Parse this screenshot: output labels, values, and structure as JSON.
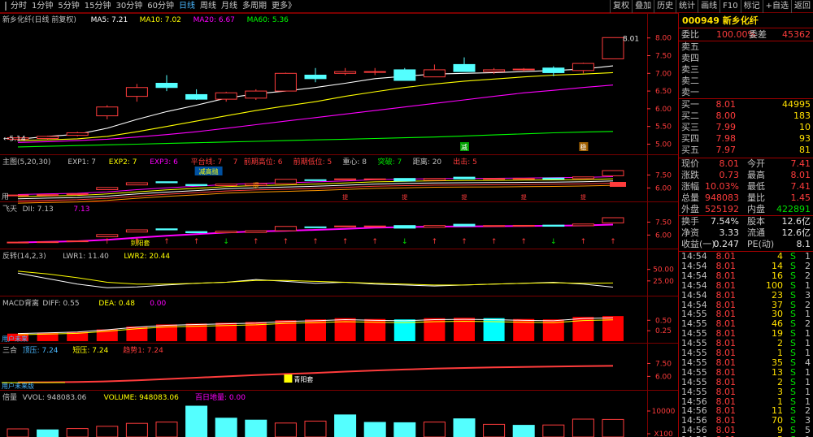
{
  "toolbar": {
    "periods": [
      "分时",
      "1分钟",
      "5分钟",
      "15分钟",
      "30分钟",
      "60分钟",
      "日线",
      "周线",
      "月线",
      "多周期",
      "更多》"
    ],
    "active_period": "日线",
    "tools": [
      "复权",
      "叠加",
      "历史",
      "统计",
      "画线",
      "F10",
      "标记",
      "+自选",
      "返回"
    ]
  },
  "colors": {
    "up": "#ff3c3c",
    "down": "#54ffff",
    "ma5": "#ffffff",
    "ma10": "#ffff00",
    "ma20": "#ff00ff",
    "ma60": "#00ff00",
    "grid": "#7a0000",
    "axis": "#ff3c3c"
  },
  "panes": {
    "main": {
      "title": "新乡化纤(日线 前复权)",
      "ma5": "MA5: 7.21",
      "ma10": "MA10: 7.02",
      "ma20": "MA20: 6.67",
      "ma60": "MA60: 5.36",
      "high_label": "8.01",
      "low_label": "5.14",
      "ticks": [
        "8.00",
        "7.50",
        "7.00",
        "6.50",
        "6.00",
        "5.50",
        "5.00"
      ],
      "marks": [
        "减",
        "稳"
      ]
    },
    "zhutu": {
      "items": [
        "主图(5,20,30)",
        "EXP1: 7",
        "EXP2: 7",
        "EXP3: 6",
        "平台线: 7",
        "7",
        "前期高位: 6",
        "前期低位: 5",
        "重心: 8",
        "突破: 7",
        "距离: 20",
        "出击: 5"
      ],
      "left_tag": "用",
      "mid_tag": "减高抛",
      "tag2": "提",
      "ticks": [
        "7.50",
        "6.00"
      ],
      "labels": [
        "提",
        "提",
        "提",
        "提",
        "提"
      ]
    },
    "feitian": {
      "items": [
        "飞天",
        "DII: 7.13",
        "7.13"
      ],
      "tag": "到阳套",
      "ticks": [
        "7.50",
        "6.00"
      ]
    },
    "fanzhong": {
      "items": [
        "反转(14,2,3)",
        "LWR1: 11.40",
        "LWR2: 20.44"
      ],
      "ticks": [
        "50.00",
        "25.00"
      ]
    },
    "macd": {
      "items": [
        "MACD背离",
        "DIFF: 0.55",
        "DEA: 0.48",
        "0.00"
      ],
      "left_tag": "用户未来",
      "ticks": [
        "0.50",
        "0.25"
      ]
    },
    "sanhe": {
      "items": [
        "三合",
        "顶压: 7.24",
        "短压: 7.24",
        "趋势1: 7.24"
      ],
      "left_tag": "用户未来版",
      "tag": "青阳套",
      "ticks": [
        "7.50",
        "6.00"
      ]
    },
    "volume": {
      "items": [
        "倍量",
        "VVOL: 948083.06",
        "VOLUME: 948083.06",
        "百日地量: 0.00"
      ],
      "ticks": [
        "10000",
        "X100"
      ]
    }
  },
  "chart_data": {
    "type": "candlestick",
    "x": [
      1,
      2,
      3,
      4,
      5,
      6,
      7,
      8,
      9,
      10,
      11,
      12,
      13,
      14,
      15,
      16,
      17,
      18,
      19,
      20
    ],
    "ohlc": [
      [
        5.14,
        5.2,
        5.1,
        5.18
      ],
      [
        5.16,
        5.24,
        5.12,
        5.22
      ],
      [
        5.25,
        5.35,
        5.22,
        5.32
      ],
      [
        5.8,
        6.1,
        5.7,
        6.05
      ],
      [
        6.35,
        6.7,
        6.2,
        6.6
      ],
      [
        6.72,
        6.95,
        6.5,
        6.6
      ],
      [
        6.4,
        6.55,
        6.25,
        6.27
      ],
      [
        6.27,
        6.48,
        6.2,
        6.45
      ],
      [
        6.3,
        6.55,
        6.25,
        6.5
      ],
      [
        6.5,
        7.02,
        6.5,
        7.0
      ],
      [
        6.95,
        7.15,
        6.75,
        6.85
      ],
      [
        7.0,
        7.15,
        6.95,
        7.05
      ],
      [
        7.05,
        7.15,
        6.95,
        7.05
      ],
      [
        7.1,
        7.15,
        6.8,
        6.8
      ],
      [
        6.9,
        7.25,
        6.9,
        7.1
      ],
      [
        7.25,
        7.45,
        7.05,
        7.05
      ],
      [
        7.05,
        7.15,
        6.98,
        7.1
      ],
      [
        7.1,
        7.15,
        7.05,
        7.12
      ],
      [
        7.15,
        7.2,
        6.92,
        7.02
      ],
      [
        7.08,
        7.3,
        7.0,
        7.28
      ],
      [
        7.41,
        8.01,
        7.41,
        8.01
      ]
    ],
    "ma5": [
      5.14,
      5.22,
      5.28,
      5.45,
      5.7,
      5.92,
      6.1,
      6.3,
      6.42,
      6.5,
      6.6,
      6.72,
      6.85,
      6.92,
      6.98,
      7.0,
      7.02,
      7.05,
      7.08,
      7.12,
      7.21
    ],
    "ma10": [
      5.1,
      5.12,
      5.15,
      5.22,
      5.35,
      5.5,
      5.65,
      5.8,
      5.95,
      6.08,
      6.2,
      6.35,
      6.48,
      6.6,
      6.7,
      6.78,
      6.84,
      6.9,
      6.95,
      6.98,
      7.02
    ],
    "ma20": [
      5.05,
      5.07,
      5.1,
      5.14,
      5.2,
      5.27,
      5.35,
      5.45,
      5.55,
      5.65,
      5.75,
      5.85,
      5.95,
      6.05,
      6.15,
      6.25,
      6.35,
      6.45,
      6.52,
      6.6,
      6.67
    ],
    "ma60": [
      4.92,
      4.94,
      4.96,
      4.98,
      5.0,
      5.02,
      5.04,
      5.06,
      5.08,
      5.1,
      5.12,
      5.14,
      5.16,
      5.18,
      5.2,
      5.23,
      5.26,
      5.29,
      5.32,
      5.34,
      5.36
    ],
    "ylim": [
      4.85,
      8.2
    ],
    "volume": [
      2500,
      2200,
      2600,
      3300,
      4200,
      4600,
      9500,
      5800,
      5200,
      4300,
      4900,
      6800,
      4500,
      4400,
      4600,
      5600,
      3900,
      3600,
      3700,
      5500,
      5400
    ],
    "vol_up": [
      true,
      false,
      true,
      true,
      true,
      true,
      false,
      false,
      false,
      true,
      true,
      false,
      false,
      false,
      true,
      false,
      true,
      false,
      true,
      true,
      true
    ],
    "macd": [
      0.18,
      0.2,
      0.22,
      0.28,
      0.35,
      0.4,
      0.42,
      0.44,
      0.46,
      0.5,
      0.52,
      0.55,
      0.53,
      0.52,
      0.55,
      0.56,
      0.55,
      0.53,
      0.52,
      0.58,
      0.6
    ],
    "macd_up": [
      true,
      true,
      true,
      true,
      true,
      true,
      true,
      true,
      true,
      true,
      true,
      true,
      true,
      false,
      true,
      true,
      false,
      true,
      true,
      true,
      true
    ],
    "lwr1": [
      42,
      30,
      18,
      10,
      12,
      16,
      20,
      22,
      28,
      24,
      20,
      22,
      18,
      16,
      14,
      16,
      18,
      20,
      22,
      18,
      11.4
    ],
    "lwr2": [
      46,
      40,
      32,
      22,
      18,
      18,
      20,
      22,
      26,
      26,
      24,
      22,
      20,
      18,
      16,
      16,
      18,
      20,
      21,
      20,
      20.44
    ]
  },
  "quote": {
    "code": "000949",
    "name": "新乡化纤",
    "wei_bi": "委比",
    "wei_bi_val": "100.00%",
    "wei_cha": "委差",
    "wei_cha_val": "45362",
    "sell": [
      "卖五",
      "卖四",
      "卖三",
      "卖二",
      "卖一"
    ],
    "buy": [
      {
        "label": "买一",
        "price": "8.01",
        "vol": "44995"
      },
      {
        "label": "买二",
        "price": "8.00",
        "vol": "183"
      },
      {
        "label": "买三",
        "price": "7.99",
        "vol": "10"
      },
      {
        "label": "买四",
        "price": "7.98",
        "vol": "93"
      },
      {
        "label": "买五",
        "price": "7.97",
        "vol": "81"
      }
    ],
    "stats": [
      {
        "l1": "现价",
        "v1": "8.01",
        "l2": "今开",
        "v2": "7.41"
      },
      {
        "l1": "涨跌",
        "v1": "0.73",
        "l2": "最高",
        "v2": "8.01"
      },
      {
        "l1": "涨幅",
        "v1": "10.03%",
        "l2": "最低",
        "v2": "7.41"
      },
      {
        "l1": "总量",
        "v1": "948083",
        "l2": "量比",
        "v2": "1.45"
      },
      {
        "l1": "外盘",
        "v1": "525192",
        "l2": "内盘",
        "v2": "422891"
      }
    ],
    "stats2": [
      {
        "l1": "换手",
        "v1": "7.54%",
        "l2": "股本",
        "v2": "12.6亿"
      },
      {
        "l1": "净资",
        "v1": "3.33",
        "l2": "流通",
        "v2": "12.6亿"
      },
      {
        "l1": "收益(一)",
        "v1": "0.247",
        "l2": "PE(动)",
        "v2": "8.1"
      }
    ],
    "ticks": [
      {
        "t": "14:54",
        "p": "8.01",
        "v": "4",
        "bs": "S",
        "n": "1"
      },
      {
        "t": "14:54",
        "p": "8.01",
        "v": "14",
        "bs": "S",
        "n": "2"
      },
      {
        "t": "14:54",
        "p": "8.01",
        "v": "16",
        "bs": "S",
        "n": "2"
      },
      {
        "t": "14:54",
        "p": "8.01",
        "v": "100",
        "bs": "S",
        "n": "1"
      },
      {
        "t": "14:54",
        "p": "8.01",
        "v": "23",
        "bs": "S",
        "n": "3"
      },
      {
        "t": "14:54",
        "p": "8.01",
        "v": "37",
        "bs": "S",
        "n": "2"
      },
      {
        "t": "14:55",
        "p": "8.01",
        "v": "30",
        "bs": "S",
        "n": "1"
      },
      {
        "t": "14:55",
        "p": "8.01",
        "v": "46",
        "bs": "S",
        "n": "2"
      },
      {
        "t": "14:55",
        "p": "8.01",
        "v": "19",
        "bs": "S",
        "n": "1"
      },
      {
        "t": "14:55",
        "p": "8.01",
        "v": "2",
        "bs": "S",
        "n": "1"
      },
      {
        "t": "14:55",
        "p": "8.01",
        "v": "1",
        "bs": "S",
        "n": "1"
      },
      {
        "t": "14:55",
        "p": "8.01",
        "v": "35",
        "bs": "S",
        "n": "4"
      },
      {
        "t": "14:55",
        "p": "8.01",
        "v": "13",
        "bs": "S",
        "n": "1"
      },
      {
        "t": "14:55",
        "p": "8.01",
        "v": "2",
        "bs": "S",
        "n": "1"
      },
      {
        "t": "14:55",
        "p": "8.01",
        "v": "3",
        "bs": "S",
        "n": "1"
      },
      {
        "t": "14:56",
        "p": "8.01",
        "v": "1",
        "bs": "S",
        "n": "1"
      },
      {
        "t": "14:56",
        "p": "8.01",
        "v": "11",
        "bs": "S",
        "n": "2"
      },
      {
        "t": "14:56",
        "p": "8.01",
        "v": "70",
        "bs": "S",
        "n": "3"
      },
      {
        "t": "14:56",
        "p": "8.01",
        "v": "9",
        "bs": "S",
        "n": "5"
      },
      {
        "t": "14:56",
        "p": "8.01",
        "v": "5",
        "bs": "S",
        "n": "1"
      }
    ]
  }
}
